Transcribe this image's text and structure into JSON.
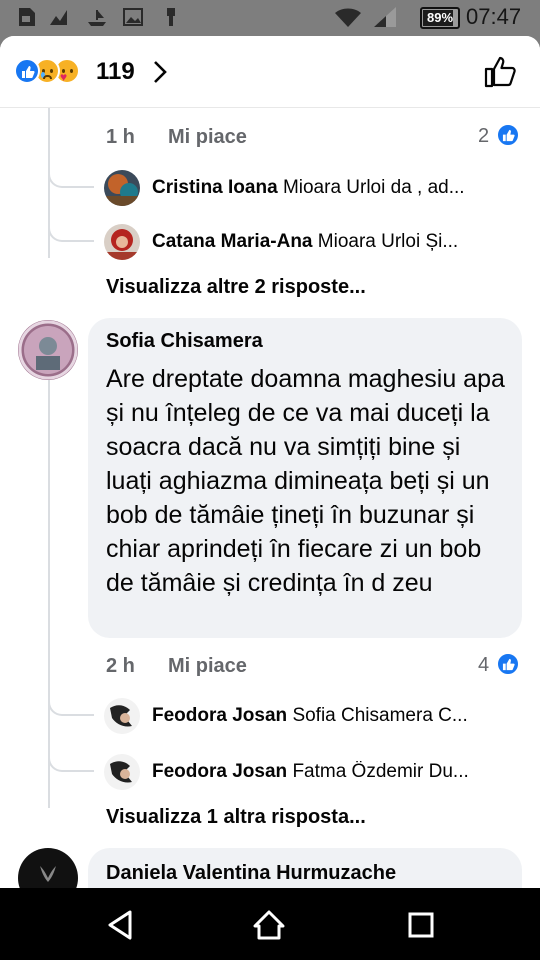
{
  "status_bar": {
    "battery": "89%",
    "battery_level": 0.89,
    "time": "07:47",
    "icons": [
      "sim-icon",
      "chart-icon",
      "ship-icon",
      "image-icon",
      "usb-icon",
      "wifi-icon",
      "signal-icon",
      "battery-icon"
    ]
  },
  "header": {
    "reaction_icons": [
      "like-reaction-icon",
      "sad-reaction-icon",
      "care-reaction-icon"
    ],
    "reaction_count": "119"
  },
  "thread_top": {
    "time": "1 h",
    "like_label": "Mi piace",
    "like_count": "2",
    "replies": [
      {
        "name": "Cristina Ioana",
        "text": "Mioara Urloi da , ad..."
      },
      {
        "name": "Catana Maria-Ana",
        "text": "Mioara Urloi Și..."
      }
    ],
    "more_replies": "Visualizza altre 2 risposte..."
  },
  "comment": {
    "author": "Sofia Chisamera",
    "text": "Are dreptate doamna maghesiu apa și nu înțeleg de ce va mai duceți la soacra dacă nu va simțiți bine și luați aghiazma dimineața beți  și un bob de tămâie  țineți în buzunar și chiar aprindeți  în fiecare zi un bob de tămâie și credința în d zeu",
    "time": "2 h",
    "like_label": "Mi piace",
    "like_count": "4",
    "replies": [
      {
        "name": "Feodora Josan",
        "text": "Sofia Chisamera C..."
      },
      {
        "name": "Feodora Josan",
        "text": "Fatma Özdemir Du..."
      }
    ],
    "more_replies": "Visualizza 1 altra risposta..."
  },
  "next_comment": {
    "author": "Daniela Valentina Hurmuzache"
  },
  "colors": {
    "facebook_blue": "#1877f2",
    "bubble_bg": "#f0f2f5",
    "meta_gray": "#65676b",
    "status_bar_gray": "#7e7e7e"
  }
}
